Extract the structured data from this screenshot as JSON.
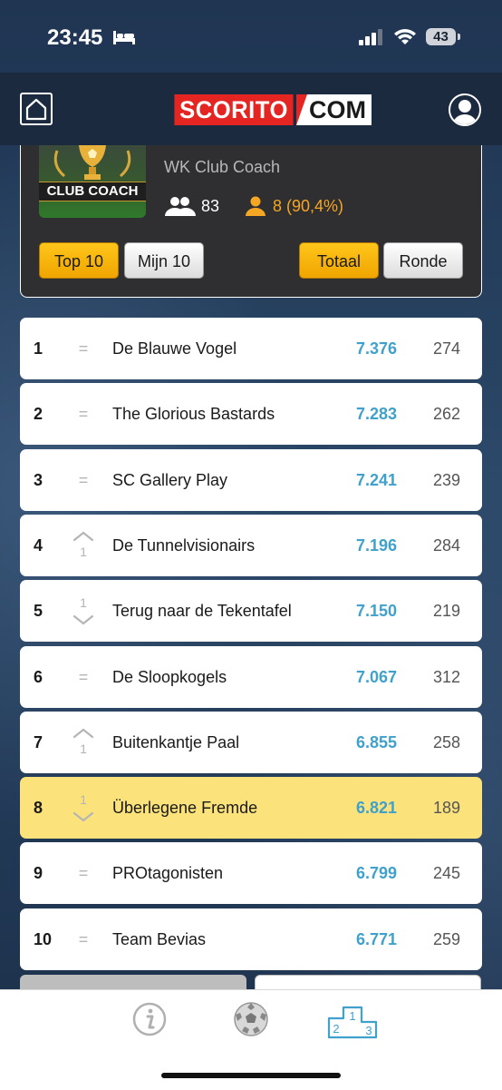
{
  "status": {
    "time": "23:45",
    "battery": "43"
  },
  "header": {
    "logo_left": "SCORITO",
    "logo_right": "COM"
  },
  "game": {
    "badge": "CLUB COACH",
    "title": "WK Club Coach",
    "players": "83",
    "position": "8 (90,4%)"
  },
  "buttons": {
    "top10": "Top 10",
    "mijn10": "Mijn 10",
    "totaal": "Totaal",
    "ronde": "Ronde"
  },
  "colors": {
    "accent_yellow": "#f5a623",
    "points_blue": "#3fa1cc",
    "highlight": "#fbe27a",
    "brand_red": "#e52521"
  },
  "ranking": [
    {
      "rank": "1",
      "move": "=",
      "move_num": "",
      "name": "De Blauwe Vogel",
      "points": "7.376",
      "round": "274"
    },
    {
      "rank": "2",
      "move": "=",
      "move_num": "",
      "name": "The Glorious Bastards",
      "points": "7.283",
      "round": "262"
    },
    {
      "rank": "3",
      "move": "=",
      "move_num": "",
      "name": "SC Gallery Play",
      "points": "7.241",
      "round": "239"
    },
    {
      "rank": "4",
      "move": "up",
      "move_num": "1",
      "name": "De Tunnelvisionairs",
      "points": "7.196",
      "round": "284"
    },
    {
      "rank": "5",
      "move": "down",
      "move_num": "1",
      "name": "Terug naar de Tekentafel",
      "points": "7.150",
      "round": "219"
    },
    {
      "rank": "6",
      "move": "=",
      "move_num": "",
      "name": "De Sloopkogels",
      "points": "7.067",
      "round": "312"
    },
    {
      "rank": "7",
      "move": "up",
      "move_num": "1",
      "name": "Buitenkantje Paal",
      "points": "6.855",
      "round": "258"
    },
    {
      "rank": "8",
      "move": "down",
      "move_num": "1",
      "name": "Überlegene Fremde",
      "points": "6.821",
      "round": "189",
      "highlight": true
    },
    {
      "rank": "9",
      "move": "=",
      "move_num": "",
      "name": "PROtagonisten",
      "points": "6.799",
      "round": "245"
    },
    {
      "rank": "10",
      "move": "=",
      "move_num": "",
      "name": "Team Bevias",
      "points": "6.771",
      "round": "259"
    }
  ],
  "tabs": [
    {
      "icon": "info-icon"
    },
    {
      "icon": "soccer-ball-icon"
    },
    {
      "icon": "podium-icon",
      "labels": [
        "1",
        "2",
        "3"
      ]
    }
  ]
}
